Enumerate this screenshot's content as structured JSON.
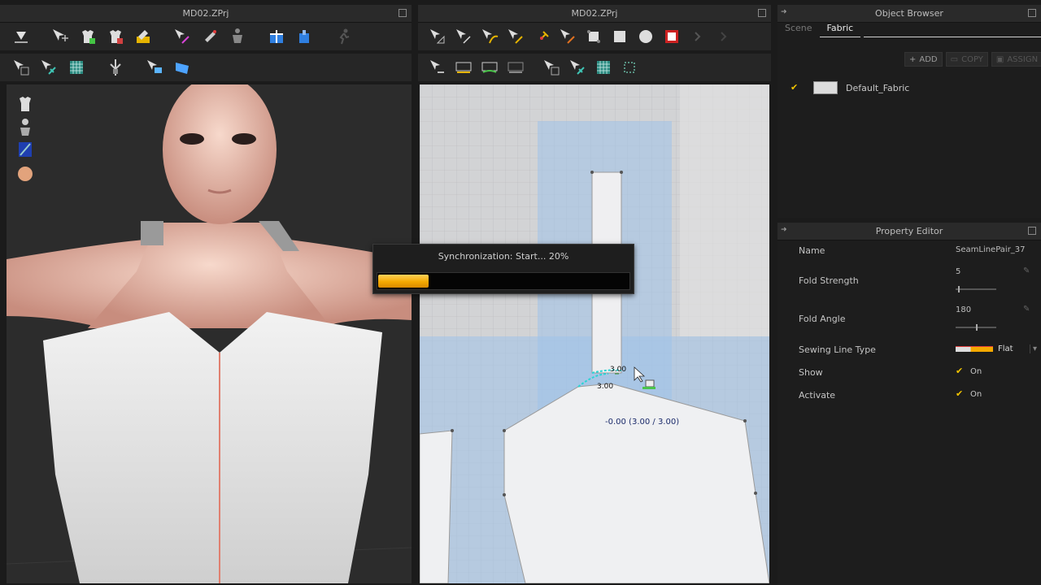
{
  "left_panel": {
    "title": "MD02.ZPrj"
  },
  "center_panel": {
    "title": "MD02.ZPrj"
  },
  "object_browser": {
    "title": "Object Browser",
    "tabs": [
      "Scene",
      "Fabric"
    ],
    "active_tab": "Fabric",
    "buttons": {
      "add": "ADD",
      "copy": "COPY",
      "assign": "ASSIGN"
    },
    "items": [
      {
        "name": "Default_Fabric",
        "checked": true
      }
    ]
  },
  "property_editor": {
    "title": "Property Editor",
    "rows": {
      "name_label": "Name",
      "name_value": "SeamLinePair_37",
      "fold_strength_label": "Fold Strength",
      "fold_strength_value": "5",
      "fold_strength_fraction": 0.05,
      "fold_angle_label": "Fold Angle",
      "fold_angle_value": "180",
      "fold_angle_fraction": 0.5,
      "sewing_type_label": "Sewing Line Type",
      "sewing_type_value": "Flat",
      "show_label": "Show",
      "show_value": "On",
      "activate_label": "Activate",
      "activate_value": "On"
    }
  },
  "progress_dialog": {
    "text": "Synchronization: Start... 20%",
    "progress": 0.2
  },
  "pattern_view": {
    "seam_label_top": "3.00",
    "seam_label_bottom": "3.00",
    "measure_text": "-0.00 (3.00 / 3.00)"
  },
  "colors": {
    "accent": "#f4a900",
    "selection": "#2ad4d4",
    "check": "#f2c400"
  }
}
